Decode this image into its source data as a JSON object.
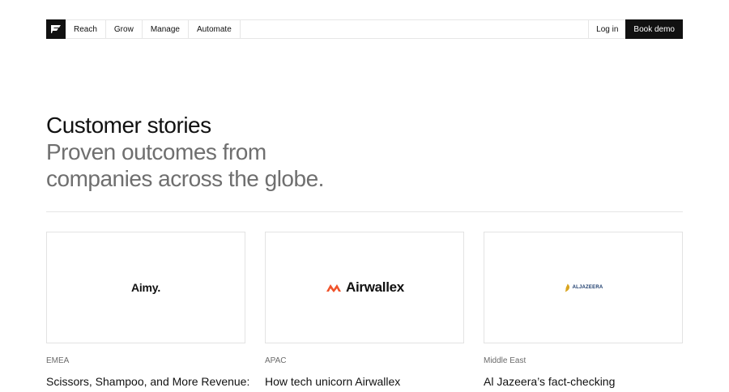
{
  "nav": {
    "links": [
      "Reach",
      "Grow",
      "Manage",
      "Automate"
    ],
    "login_label": "Log in",
    "book_label": "Book demo"
  },
  "hero": {
    "title": "Customer stories",
    "subtitle_line1": "Proven outcomes from",
    "subtitle_line2": "companies across the globe."
  },
  "cards": [
    {
      "logo_text": "Aimy.",
      "region": "EMEA",
      "title": "Scissors, Shampoo, and More Revenue:"
    },
    {
      "logo_text": "Airwallex",
      "region": "APAC",
      "title": "How tech unicorn Airwallex"
    },
    {
      "logo_text": "ALJAZEERA",
      "region": "Middle East",
      "title": "Al Jazeera’s fact-checking"
    }
  ],
  "colors": {
    "airwallex_brand": "#f0532b",
    "aljazeera_gold": "#d9a520",
    "aljazeera_blue": "#1a3a6b"
  },
  "icons": {
    "logo": "brand-logo-icon"
  }
}
